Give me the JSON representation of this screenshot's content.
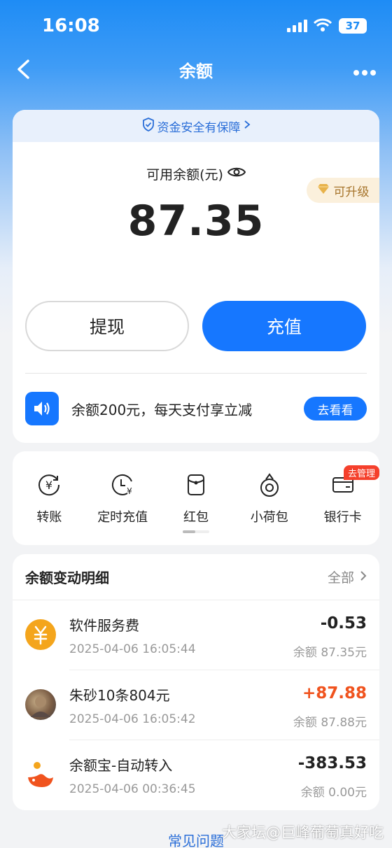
{
  "status_bar": {
    "time": "16:08",
    "battery": "37"
  },
  "nav": {
    "title": "余额"
  },
  "balance": {
    "safety_text": "资金安全有保障",
    "label": "可用余额(元)",
    "amount": "87.35",
    "upgrade_text": "可升级",
    "withdraw_label": "提现",
    "topup_label": "充值"
  },
  "promo": {
    "text": "余额200元，每天支付享立减",
    "button": "去看看"
  },
  "tools": [
    {
      "label": "转账",
      "icon": "yuan-circle-icon"
    },
    {
      "label": "定时充值",
      "icon": "clock-yuan-icon"
    },
    {
      "label": "红包",
      "icon": "red-envelope-icon"
    },
    {
      "label": "小荷包",
      "icon": "wallet-pouch-icon"
    },
    {
      "label": "银行卡",
      "icon": "bank-card-icon",
      "tag": "去管理"
    }
  ],
  "details": {
    "title": "余额变动明细",
    "all_label": "全部",
    "rows": [
      {
        "name": "软件服务费",
        "date": "2025-04-06 16:05:44",
        "amount": "-0.53",
        "balance": "余额 87.35元"
      },
      {
        "name": "朱砂10条804元",
        "date": "2025-04-06 16:05:42",
        "amount": "+87.88",
        "balance": "余额 87.88元"
      },
      {
        "name": "余额宝-自动转入",
        "date": "2025-04-06 00:36:45",
        "amount": "-383.53",
        "balance": "余额 0.00元"
      }
    ]
  },
  "footer": {
    "faq": "常见问题",
    "watermark": "大家坛@巨峰葡萄真好吃"
  },
  "colors": {
    "accent": "#1677ff",
    "positive": "#f0531e",
    "upgrade": "#a7752c"
  }
}
